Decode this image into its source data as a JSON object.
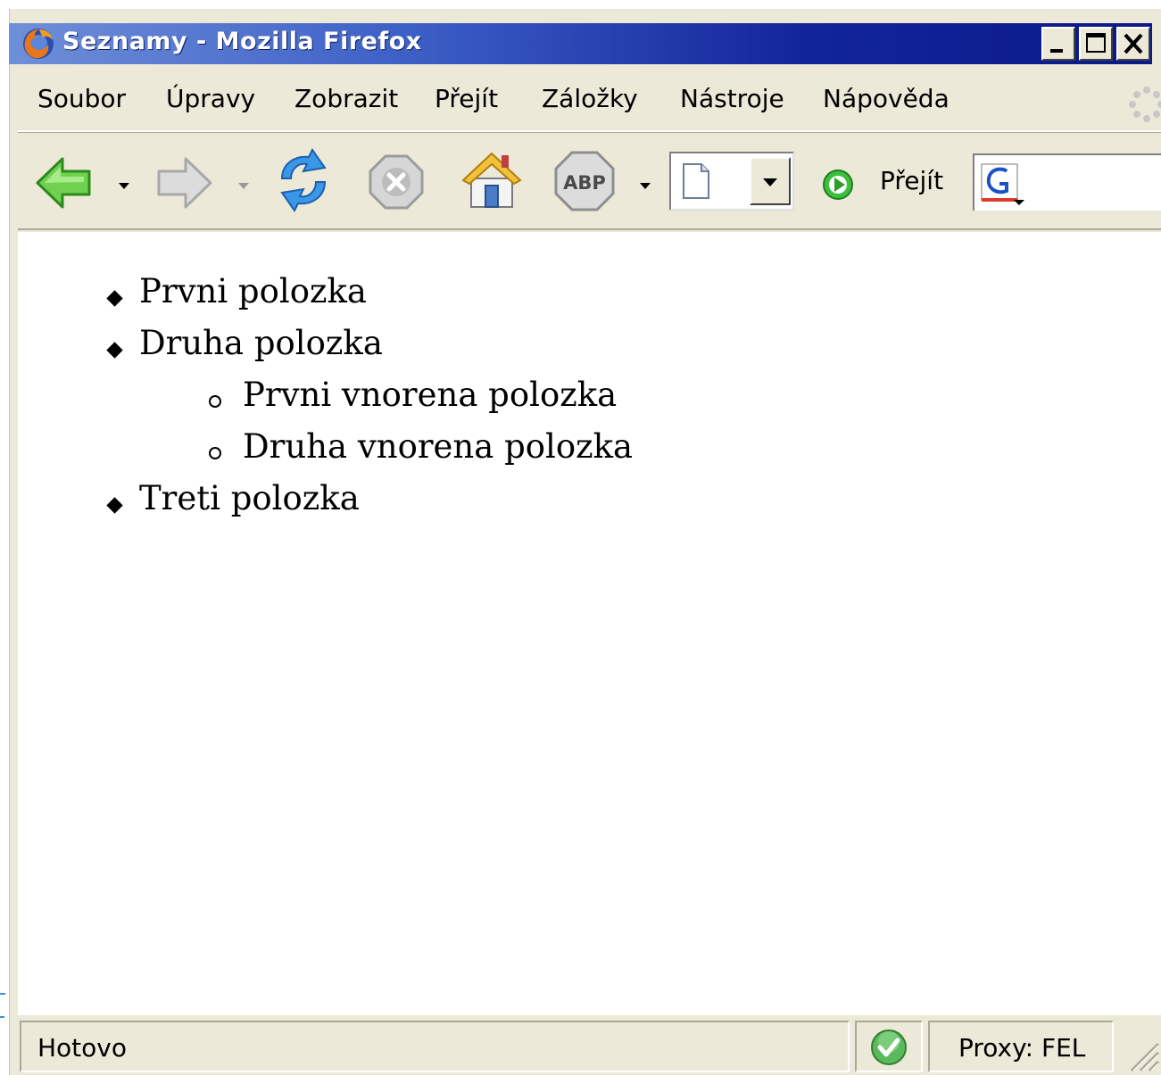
{
  "window": {
    "title": "Seznamy - Mozilla Firefox",
    "controls": [
      "minimize-icon",
      "maximize-icon",
      "close-icon"
    ]
  },
  "menubar": {
    "items": [
      {
        "label": "Soubor"
      },
      {
        "label": "Úpravy"
      },
      {
        "label": "Zobrazit"
      },
      {
        "label": "Přejít"
      },
      {
        "label": "Záložky"
      },
      {
        "label": "Nástroje"
      },
      {
        "label": "Nápověda"
      }
    ]
  },
  "toolbar": {
    "buttons": [
      "back-icon",
      "forward-icon",
      "reload-icon",
      "stop-icon",
      "home-icon",
      "adblock-plus-icon"
    ],
    "adblock_label": "ABP",
    "go_label": "Přejít",
    "url_value": "",
    "search_value": ""
  },
  "content": {
    "list": [
      {
        "text": "Prvni polozka",
        "level": 1
      },
      {
        "text": "Druha polozka",
        "level": 1
      },
      {
        "text": "Prvni vnorena polozka",
        "level": 2
      },
      {
        "text": "Druha vnorena polozka",
        "level": 2
      },
      {
        "text": "Treti polozka",
        "level": 1
      }
    ]
  },
  "statusbar": {
    "status": "Hotovo",
    "proxy": "Proxy: FEL"
  },
  "colors": {
    "titlebar_start": "#6f8fd8",
    "titlebar_end": "#0a1a8a",
    "chrome": "#ece9d8",
    "content_bg": "#ffffff"
  }
}
